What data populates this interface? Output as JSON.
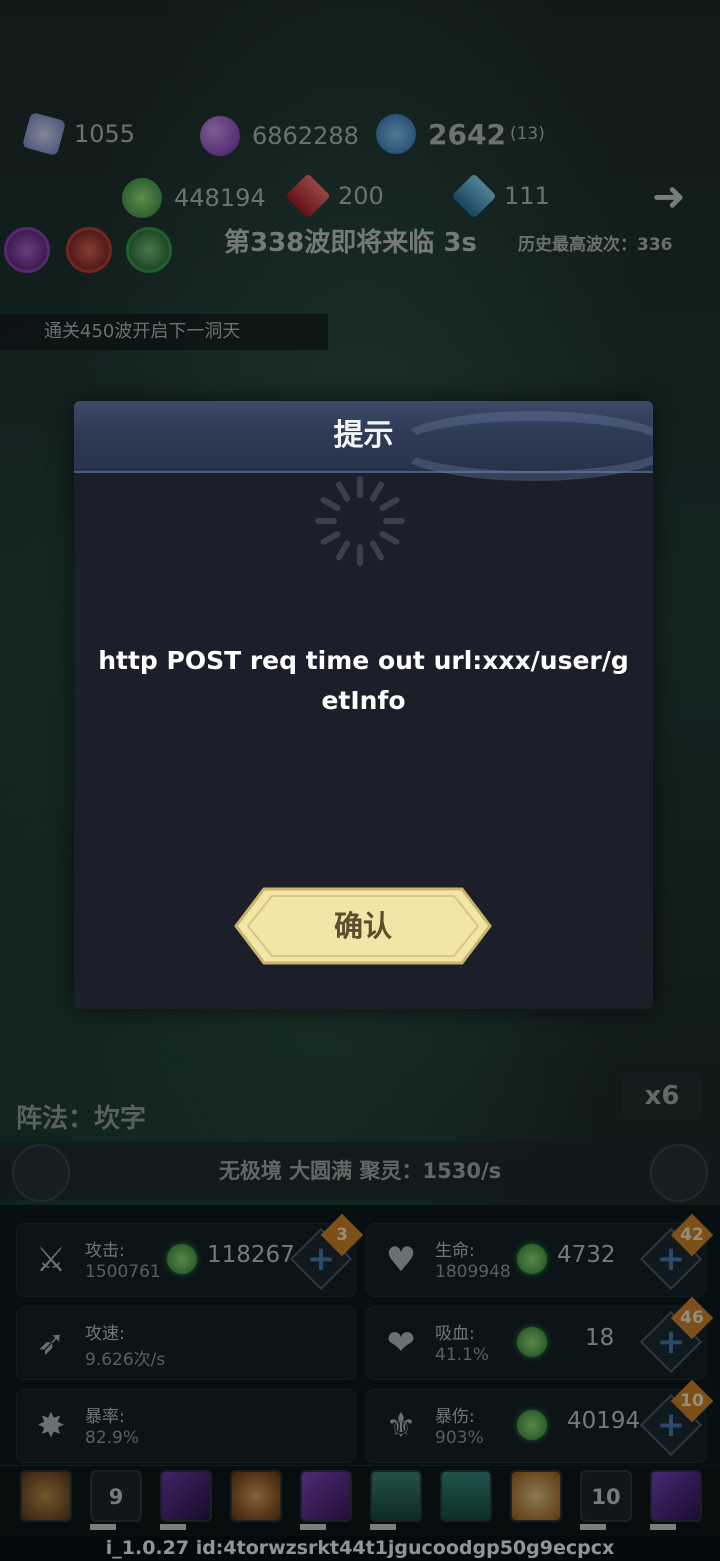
{
  "resources": {
    "crystal": "1055",
    "orb": "6862288",
    "energy": "2642",
    "energy_sub": "(13)",
    "green": "448194",
    "red": "200",
    "blue": "111"
  },
  "wave": {
    "title": "第338波即将来临 3s",
    "best": "历史最高波次：336",
    "unlock_hint": "通关450波开启下一洞天"
  },
  "modal": {
    "title": "提示",
    "message": "http POST req time out url:xxx/user/getInfo",
    "confirm": "确认"
  },
  "formation": "阵法：坎字",
  "speed": "x6",
  "realm": "无极境 大圆满 聚灵：1530/s",
  "stats": [
    {
      "icon": "sword-icon",
      "label": "攻击:",
      "sub": "1500761",
      "value": "118267",
      "badge": "3"
    },
    {
      "icon": "heart-icon",
      "label": "生命:",
      "sub": "1809948",
      "value": "4732",
      "badge": "42"
    },
    {
      "icon": "speed-icon",
      "label": "攻速:",
      "sub": "9.626次/s",
      "value": "",
      "badge": ""
    },
    {
      "icon": "vampire-heart-icon",
      "label": "吸血:",
      "sub": "41.1%",
      "value": "18",
      "badge": "46"
    },
    {
      "icon": "crit-icon",
      "label": "暴率:",
      "sub": "82.9%",
      "value": "",
      "badge": ""
    },
    {
      "icon": "crit-damage-icon",
      "label": "暴伤:",
      "sub": "903%",
      "value": "40194",
      "badge": "10"
    }
  ],
  "skills": [
    "",
    "9",
    "",
    "",
    "",
    "",
    "",
    "",
    "10",
    ""
  ],
  "version": "i_1.0.27 id:4torwzsrkt44t1jgucoodgp50g9ecpcx",
  "colors": {
    "accent_gold": "#efe3a2",
    "panel": "#1c1f2a",
    "header": "#2f3b56"
  }
}
